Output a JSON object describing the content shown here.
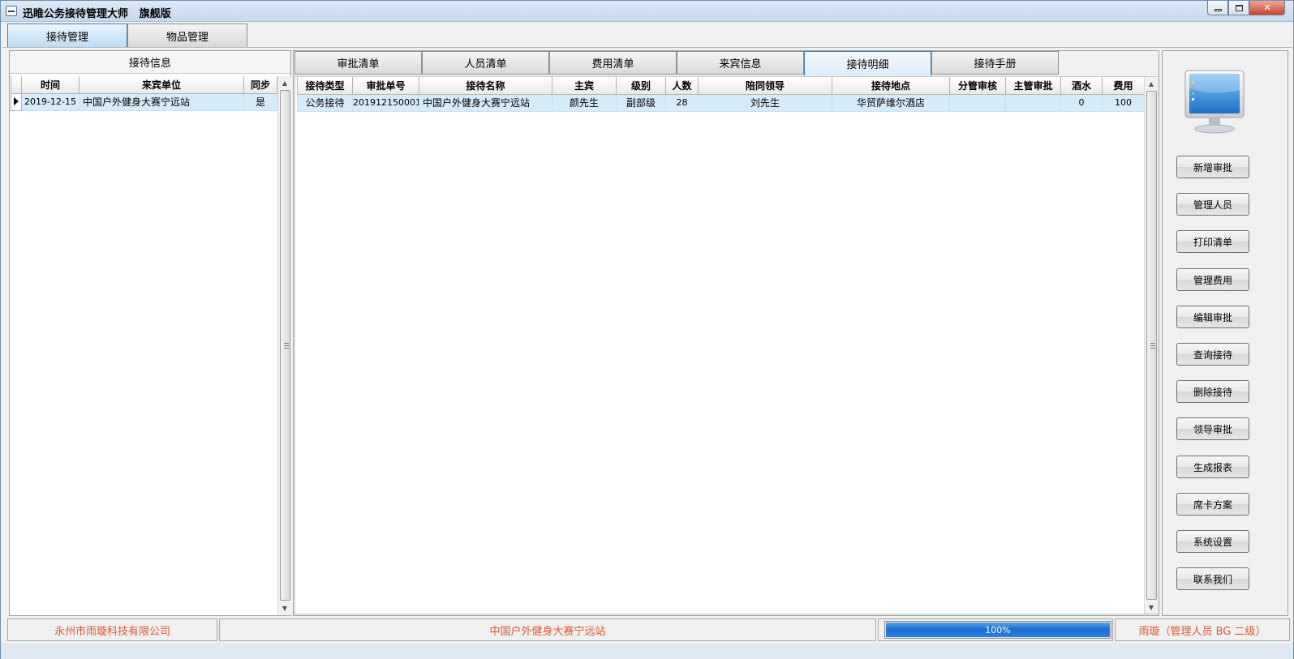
{
  "window": {
    "title": "迅睢公务接待管理大师   旗舰版"
  },
  "top_tabs": [
    {
      "label": "接待管理",
      "active": true
    },
    {
      "label": "物品管理",
      "active": false
    }
  ],
  "left_panel": {
    "header": "接待信息",
    "columns": [
      "时间",
      "来宾单位",
      "同步"
    ],
    "rows": [
      {
        "time": "2019-12-15",
        "unit": "中国户外健身大赛宁远站",
        "sync": "是"
      }
    ]
  },
  "sub_tabs": [
    {
      "label": "审批清单",
      "active": false
    },
    {
      "label": "人员清单",
      "active": false
    },
    {
      "label": "费用清单",
      "active": false
    },
    {
      "label": "来宾信息",
      "active": false
    },
    {
      "label": "接待明细",
      "active": true
    },
    {
      "label": "接待手册",
      "active": false
    }
  ],
  "detail_grid": {
    "columns": [
      "接待类型",
      "审批单号",
      "接待名称",
      "主宾",
      "级别",
      "人数",
      "陪同领导",
      "接待地点",
      "分管审核",
      "主管审批",
      "酒水",
      "费用"
    ],
    "rows": [
      [
        "公务接待",
        "201912150001",
        "中国户外健身大赛宁远站",
        "颜先生",
        "副部级",
        "28",
        "刘先生",
        "华贸萨维尔酒店",
        "",
        "",
        "0",
        "100"
      ]
    ]
  },
  "side_buttons": [
    "新增审批",
    "管理人员",
    "打印清单",
    "管理费用",
    "编辑审批",
    "查询接待",
    "删除接待",
    "领导审批",
    "生成报表",
    "席卡方案",
    "系统设置",
    "联系我们"
  ],
  "status_bar": {
    "company": "永州市雨璇科技有限公司",
    "current_unit": "中国户外健身大赛宁远站",
    "progress_percent": 100,
    "progress_text": "100%",
    "user_info": "雨璇（管理人员  BG  二级）"
  },
  "colors": {
    "status_text": "#e0582f",
    "selected_row": "#d6ebfa",
    "progress": "#1a6fd0"
  },
  "icons": {
    "monitor": "monitor-icon",
    "system_menu": "system-menu-icon"
  }
}
